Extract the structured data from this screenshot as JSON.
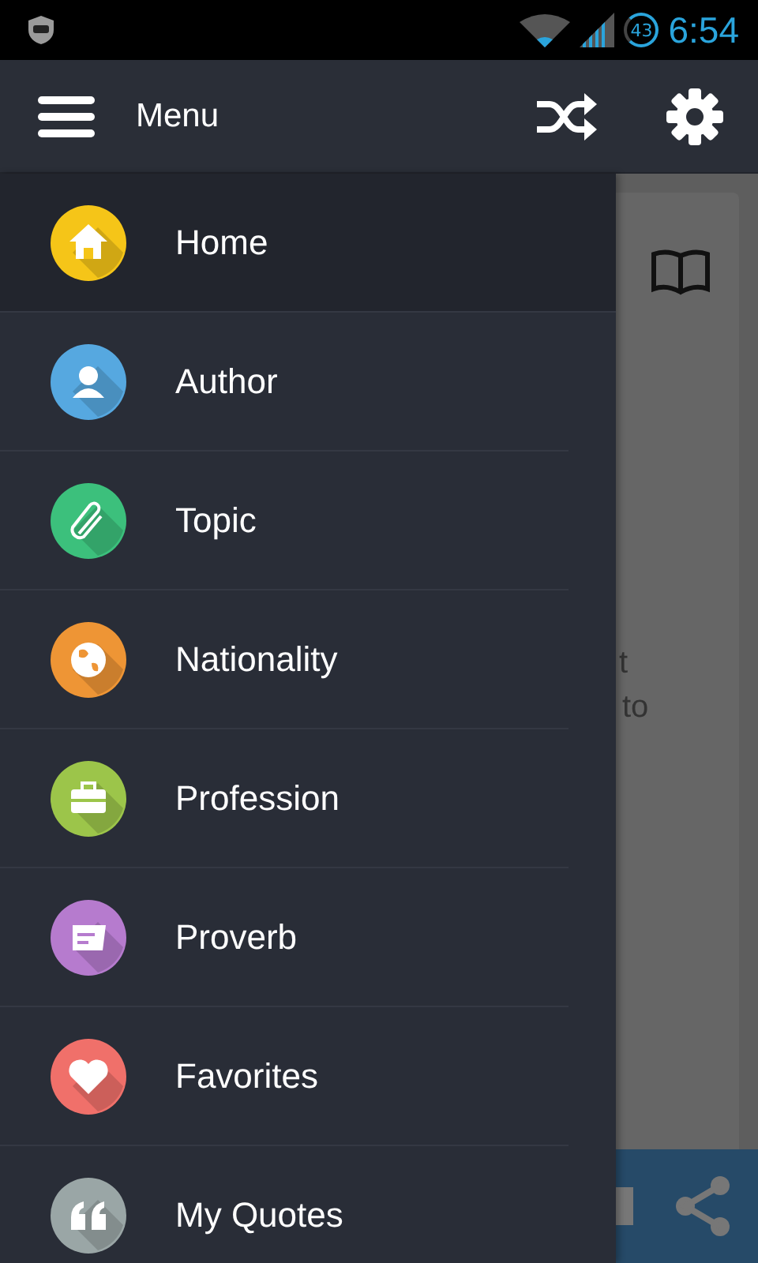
{
  "status_bar": {
    "battery": "43",
    "time": "6:54"
  },
  "toolbar": {
    "title": "Menu"
  },
  "background": {
    "text_lines": [
      "t",
      "to"
    ]
  },
  "drawer": {
    "items": [
      {
        "label": "Home",
        "color": "#f5c518",
        "selected": true
      },
      {
        "label": "Author",
        "color": "#56a8e0",
        "selected": false
      },
      {
        "label": "Topic",
        "color": "#3cc07c",
        "selected": false
      },
      {
        "label": "Nationality",
        "color": "#ee9535",
        "selected": false
      },
      {
        "label": "Profession",
        "color": "#9cc54a",
        "selected": false
      },
      {
        "label": "Proverb",
        "color": "#b67bce",
        "selected": false
      },
      {
        "label": "Favorites",
        "color": "#f0706a",
        "selected": false
      },
      {
        "label": "My Quotes",
        "color": "#9aa6a6",
        "selected": false
      }
    ]
  }
}
